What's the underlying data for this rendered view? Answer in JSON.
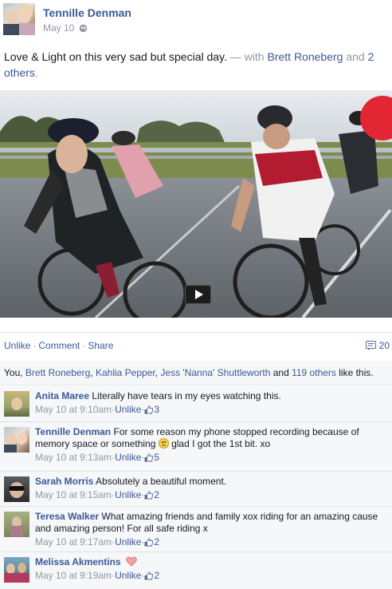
{
  "post": {
    "author": "Tennille Denman",
    "date": "May 10",
    "privacy_icon": "globe-icon",
    "text_main": "Love & Light on this very sad but special day.",
    "text_with": " — with ",
    "tagged_1": "Brett Roneberg",
    "text_and": " and ",
    "tagged_others": "2 others",
    "text_end": "."
  },
  "video": {
    "play_icon": "play-icon"
  },
  "actions": {
    "unlike": "Unlike",
    "comment": "Comment",
    "share": "Share",
    "separator": "·",
    "comment_count": "20",
    "comment_icon": "comment-icon"
  },
  "likes": {
    "prefix": "You, ",
    "liker_1": "Brett Roneberg",
    "comma_1": ", ",
    "liker_2": "Kahlia Pepper",
    "comma_2": ", ",
    "liker_3": "Jess 'Nanna' Shuttleworth",
    "and_text": " and ",
    "others": "119 others",
    "suffix": " like this."
  },
  "comments": [
    {
      "name": "Anita Maree",
      "text": "Literally have tears in my eyes watching this.",
      "time": "May 10 at 9:10am",
      "unlike": "Unlike",
      "likes": "3"
    },
    {
      "name": "Tennille Denman",
      "text": "For some reason my phone stopped recording because of memory space or something",
      "text_after": " glad I got the 1st bit. xo",
      "time": "May 10 at 9:13am",
      "unlike": "Unlike",
      "likes": "5"
    },
    {
      "name": "Sarah Morris",
      "text": "Absolutely a beautiful moment.",
      "time": "May 10 at 9:15am",
      "unlike": "Unlike",
      "likes": "2"
    },
    {
      "name": "Teresa Walker",
      "text": "What amazing friends and family xox riding for an amazing cause and amazing person! For all safe riding x",
      "time": "May 10 at 9:17am",
      "unlike": "Unlike",
      "likes": "2"
    },
    {
      "name": "Melissa Akmentins",
      "text": "",
      "time": "May 10 at 9:19am",
      "unlike": "Unlike",
      "likes": "2"
    }
  ],
  "meta_separator": " · ",
  "colors": {
    "link": "#3b5998",
    "muted": "#9197a3",
    "panel": "#f6f7f9"
  }
}
